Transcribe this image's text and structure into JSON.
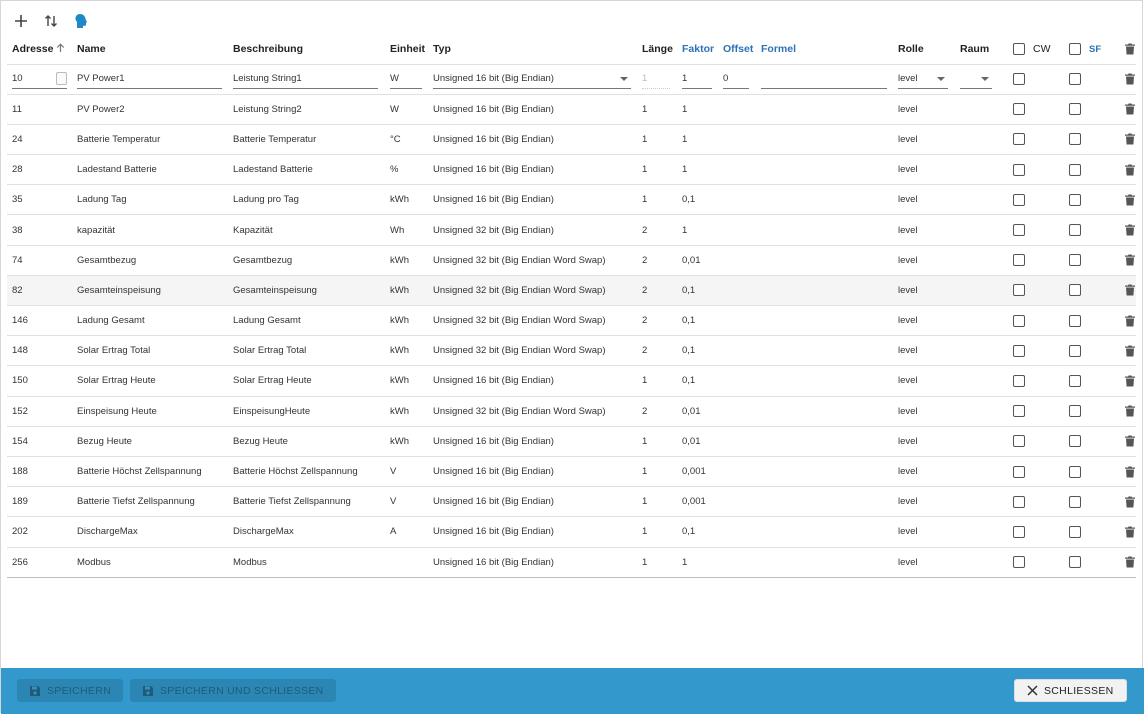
{
  "toolbar": {
    "icons": [
      "add-icon",
      "import-export-icon",
      "head-icon"
    ]
  },
  "table": {
    "headers": {
      "address": "Adresse",
      "name": "Name",
      "description": "Beschreibung",
      "unit": "Einheit",
      "type": "Typ",
      "length": "Länge",
      "factor": "Faktor",
      "offset": "Offset",
      "formula": "Formel",
      "role": "Rolle",
      "room": "Raum",
      "cw": "CW",
      "sf": "SF"
    },
    "edit_row": {
      "address": "10",
      "name": "PV Power1",
      "description": "Leistung String1",
      "unit": "W",
      "type": "Unsigned 16 bit (Big Endian)",
      "length": "1",
      "factor": "1",
      "offset": "0",
      "formula": "",
      "role": "level",
      "room": ""
    },
    "rows": [
      {
        "address": "11",
        "name": "PV Power2",
        "description": "Leistung String2",
        "unit": "W",
        "type": "Unsigned 16 bit (Big Endian)",
        "length": "1",
        "factor": "1",
        "role": "level"
      },
      {
        "address": "24",
        "name": "Batterie Temperatur",
        "description": "Batterie Temperatur",
        "unit": "°C",
        "type": "Unsigned 16 bit (Big Endian)",
        "length": "1",
        "factor": "1",
        "role": "level"
      },
      {
        "address": "28",
        "name": "Ladestand Batterie",
        "description": "Ladestand Batterie",
        "unit": "%",
        "type": "Unsigned 16 bit (Big Endian)",
        "length": "1",
        "factor": "1",
        "role": "level"
      },
      {
        "address": "35",
        "name": "Ladung Tag",
        "description": "Ladung pro Tag",
        "unit": "kWh",
        "type": "Unsigned 16 bit (Big Endian)",
        "length": "1",
        "factor": "0,1",
        "role": "level"
      },
      {
        "address": "38",
        "name": "kapazität",
        "description": "Kapazität",
        "unit": "Wh",
        "type": "Unsigned 32 bit (Big Endian)",
        "length": "2",
        "factor": "1",
        "role": "level"
      },
      {
        "address": "74",
        "name": "Gesamtbezug",
        "description": "Gesamtbezug",
        "unit": "kWh",
        "type": "Unsigned 32 bit (Big Endian Word Swap)",
        "length": "2",
        "factor": "0,01",
        "role": "level"
      },
      {
        "address": "82",
        "name": "Gesamteinspeisung",
        "description": "Gesamteinspeisung",
        "unit": "kWh",
        "type": "Unsigned 32 bit (Big Endian Word Swap)",
        "length": "2",
        "factor": "0,1",
        "role": "level"
      },
      {
        "address": "146",
        "name": "Ladung Gesamt",
        "description": "Ladung Gesamt",
        "unit": "kWh",
        "type": "Unsigned 32 bit (Big Endian Word Swap)",
        "length": "2",
        "factor": "0,1",
        "role": "level"
      },
      {
        "address": "148",
        "name": "Solar Ertrag Total",
        "description": "Solar Ertrag Total",
        "unit": "kWh",
        "type": "Unsigned 32 bit (Big Endian Word Swap)",
        "length": "2",
        "factor": "0,1",
        "role": "level"
      },
      {
        "address": "150",
        "name": "Solar Ertrag Heute",
        "description": "Solar Ertrag Heute",
        "unit": "kWh",
        "type": "Unsigned 16 bit (Big Endian)",
        "length": "1",
        "factor": "0,1",
        "role": "level"
      },
      {
        "address": "152",
        "name": "Einspeisung Heute",
        "description": "EinspeisungHeute",
        "unit": "kWh",
        "type": "Unsigned 32 bit (Big Endian Word Swap)",
        "length": "2",
        "factor": "0,01",
        "role": "level"
      },
      {
        "address": "154",
        "name": "Bezug Heute",
        "description": "Bezug Heute",
        "unit": "kWh",
        "type": "Unsigned 16 bit (Big Endian)",
        "length": "1",
        "factor": "0,01",
        "role": "level"
      },
      {
        "address": "188",
        "name": "Batterie Höchst Zellspannung",
        "description": "Batterie Höchst Zellspannung",
        "unit": "V",
        "type": "Unsigned 16 bit (Big Endian)",
        "length": "1",
        "factor": "0,001",
        "role": "level"
      },
      {
        "address": "189",
        "name": "Batterie Tiefst Zellspannung",
        "description": "Batterie Tiefst Zellspannung",
        "unit": "V",
        "type": "Unsigned 16 bit (Big Endian)",
        "length": "1",
        "factor": "0,001",
        "role": "level"
      },
      {
        "address": "202",
        "name": "DischargeMax",
        "description": "DischargeMax",
        "unit": "A",
        "type": "Unsigned 16 bit (Big Endian)",
        "length": "1",
        "factor": "0,1",
        "role": "level"
      },
      {
        "address": "256",
        "name": "Modbus",
        "description": "Modbus",
        "unit": "",
        "type": "Unsigned 16 bit (Big Endian)",
        "length": "1",
        "factor": "1",
        "role": "level"
      }
    ]
  },
  "footer": {
    "save": "SPEICHERN",
    "save_close": "SPEICHERN UND SCHLIESSEN",
    "close": "SCHLIESSEN"
  },
  "colors": {
    "accent_blue": "#2a73b8",
    "footer_bg": "#3399cc",
    "icon_blue": "#1e88c8"
  }
}
